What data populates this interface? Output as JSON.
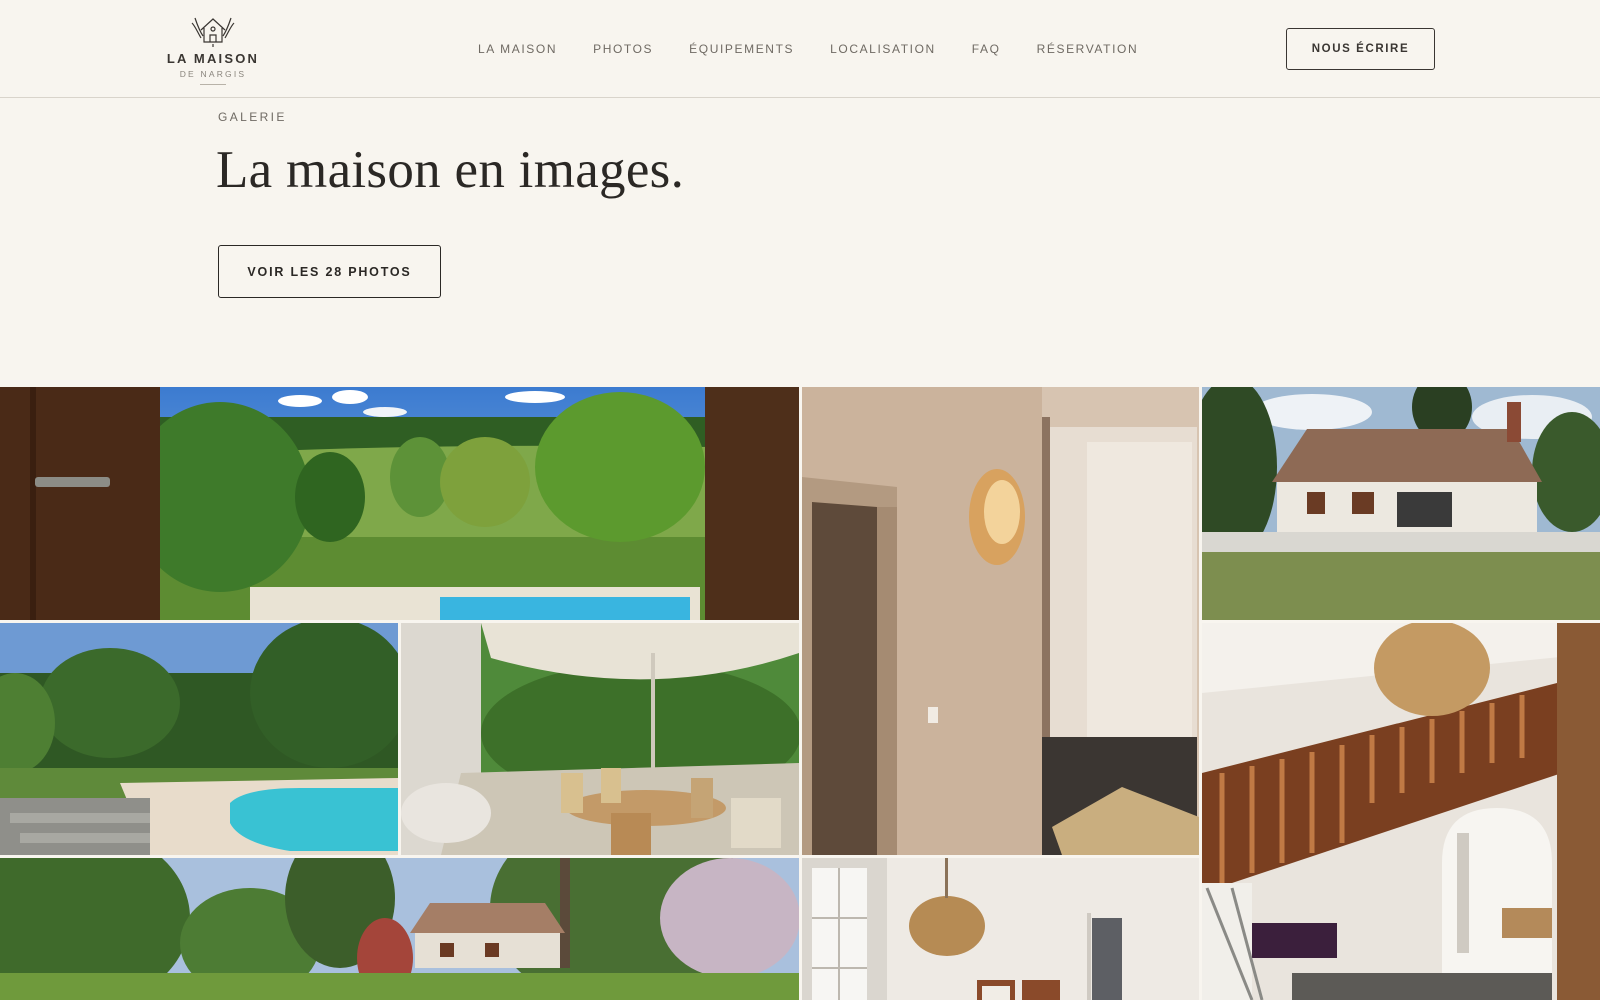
{
  "brand": {
    "title": "LA MAISON",
    "subtitle": "DE NARGIS"
  },
  "nav": {
    "items": [
      {
        "label": "LA MAISON"
      },
      {
        "label": "PHOTOS"
      },
      {
        "label": "ÉQUIPEMENTS"
      },
      {
        "label": "LOCALISATION"
      },
      {
        "label": "FAQ"
      },
      {
        "label": "RÉSERVATION"
      }
    ],
    "contact_label": "NOUS ÉCRIRE"
  },
  "hero": {
    "eyebrow": "GALERIE",
    "title": "La maison en images.",
    "cta_label": "VOIR LES 28 PHOTOS"
  },
  "gallery": {
    "photos": [
      {
        "name": "garden-view-photo"
      },
      {
        "name": "hallway-lamp-photo"
      },
      {
        "name": "house-exterior-photo"
      },
      {
        "name": "pool-photo"
      },
      {
        "name": "terrace-photo"
      },
      {
        "name": "staircase-photo"
      },
      {
        "name": "garden-house-photo"
      },
      {
        "name": "bedroom-photo"
      }
    ]
  },
  "colors": {
    "background": "#f8f5ef",
    "text": "#2b2825",
    "muted": "#6f6a63",
    "border": "#d9d4cb"
  }
}
